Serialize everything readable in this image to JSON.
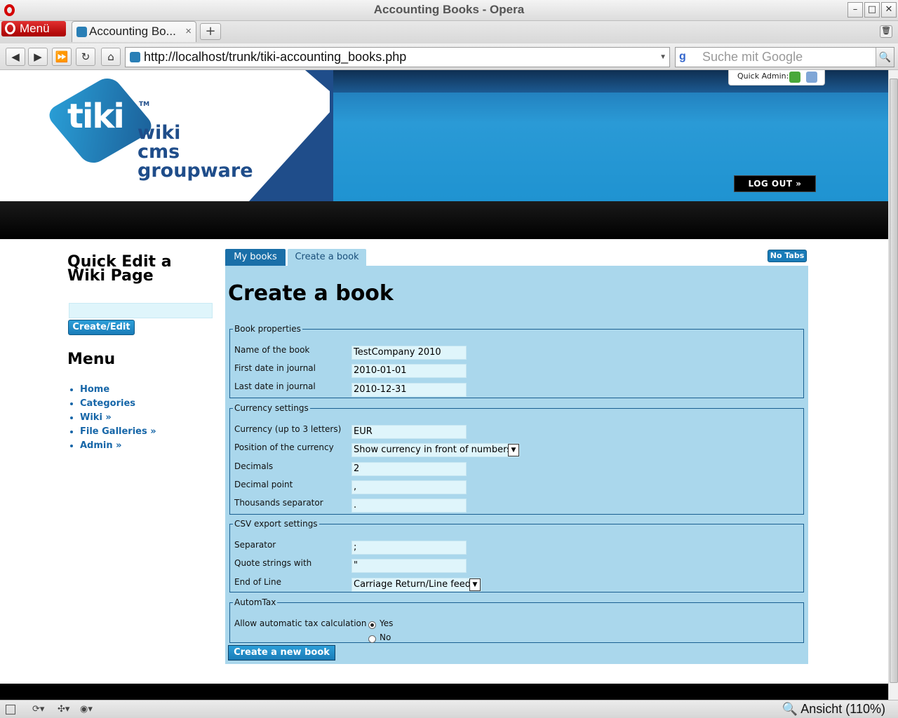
{
  "window": {
    "title": "Accounting Books - Opera"
  },
  "tabbar": {
    "menu_label": "Menü",
    "tab_title": "Accounting Bo...",
    "tab_close": "×",
    "new_tab": "+"
  },
  "navbar": {
    "url": "http://localhost/trunk/tiki-accounting_books.php",
    "search_placeholder": "Suche mit Google"
  },
  "header": {
    "logo_word": "tiki",
    "logo_tm": "TM",
    "logo_lines": [
      "wiki",
      "cms",
      "groupware"
    ],
    "quick_admin": "Quick Admin:",
    "logout": "LOG OUT »"
  },
  "sidebar": {
    "quick_edit_title": "Quick Edit a Wiki Page",
    "quick_edit_button": "Create/Edit",
    "menu_title": "Menu",
    "menu_items": [
      "Home",
      "Categories",
      "Wiki »",
      "File Galleries »",
      "Admin »"
    ]
  },
  "tabs": {
    "my_books": "My books",
    "create_book": "Create a book",
    "no_tabs": "No Tabs"
  },
  "form": {
    "heading": "Create a book",
    "book_properties": {
      "legend": "Book properties",
      "name_label": "Name of the book",
      "name_value": "TestCompany 2010",
      "first_label": "First date in journal",
      "first_value": "2010-01-01",
      "last_label": "Last date in journal",
      "last_value": "2010-12-31"
    },
    "currency": {
      "legend": "Currency settings",
      "currency_label": "Currency (up to 3 letters)",
      "currency_value": "EUR",
      "position_label": "Position of the currency",
      "position_value": "Show currency in front of numbers",
      "decimals_label": "Decimals",
      "decimals_value": "2",
      "decpoint_label": "Decimal point",
      "decpoint_value": ",",
      "thousands_label": "Thousands separator",
      "thousands_value": "."
    },
    "csv": {
      "legend": "CSV export settings",
      "separator_label": "Separator",
      "separator_value": ";",
      "quote_label": "Quote strings with",
      "quote_value": "\"",
      "eol_label": "End of Line",
      "eol_value": "Carriage Return/Line feed"
    },
    "automtax": {
      "legend": "AutomTax",
      "label": "Allow automatic tax calculation",
      "yes": "Yes",
      "no": "No",
      "selected": "Yes"
    },
    "submit": "Create a new book"
  },
  "statusbar": {
    "zoom": "Ansicht (110%)"
  }
}
